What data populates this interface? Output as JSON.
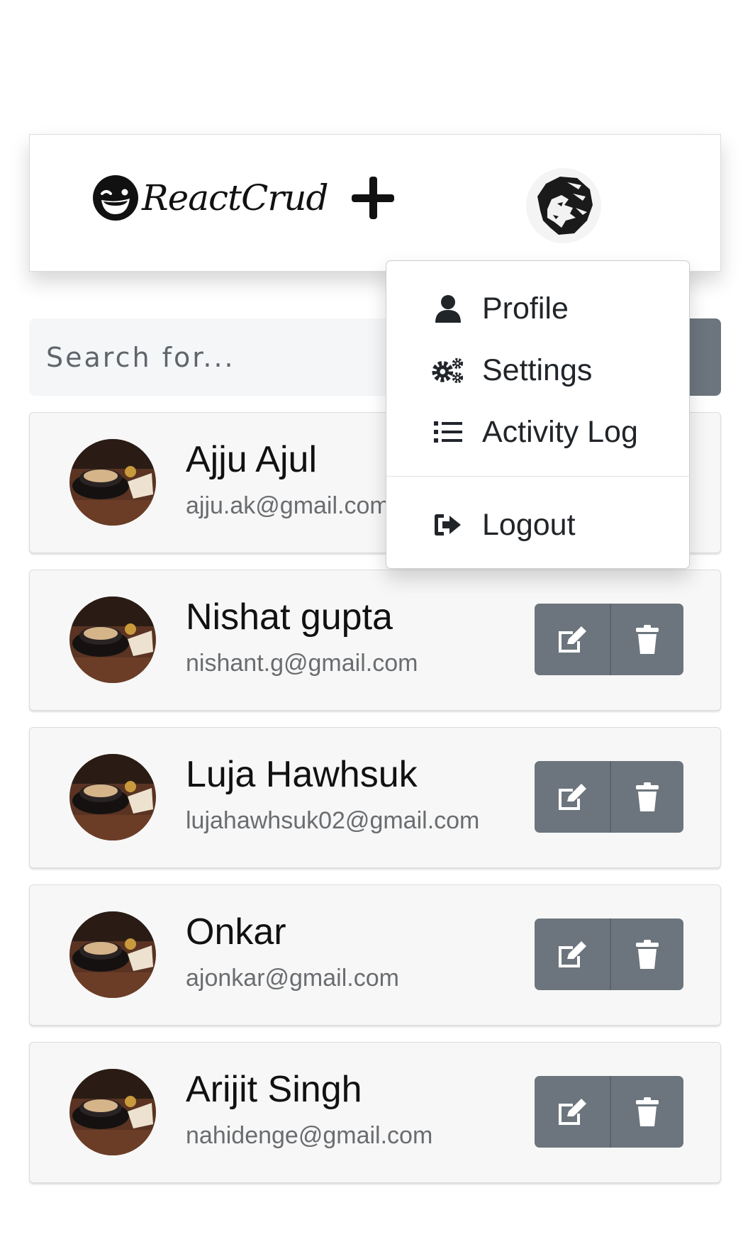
{
  "navbar": {
    "brand": "ReactCrud",
    "brand_icon": "winking-face-icon",
    "add_icon": "plus-icon",
    "avatar_icon": "lion-avatar-icon"
  },
  "search": {
    "placeholder": "Search for...",
    "icon": "search-icon"
  },
  "dropdown": {
    "items": [
      {
        "label": "Profile",
        "icon": "user-icon"
      },
      {
        "label": "Settings",
        "icon": "cogs-icon"
      },
      {
        "label": "Activity Log",
        "icon": "list-icon"
      },
      {
        "label": "Logout",
        "icon": "logout-icon"
      }
    ]
  },
  "users": [
    {
      "name": "Ajju Ajul",
      "email": "ajju.ak@gmail.com"
    },
    {
      "name": "Nishat gupta",
      "email": "nishant.g@gmail.com"
    },
    {
      "name": "Luja Hawhsuk",
      "email": "lujahawhsuk02@gmail.com"
    },
    {
      "name": "Onkar",
      "email": "ajonkar@gmail.com"
    },
    {
      "name": "Arijit Singh",
      "email": "nahidenge@gmail.com"
    }
  ],
  "colors": {
    "button": "#6c757d",
    "card_bg": "#f7f7f7"
  }
}
